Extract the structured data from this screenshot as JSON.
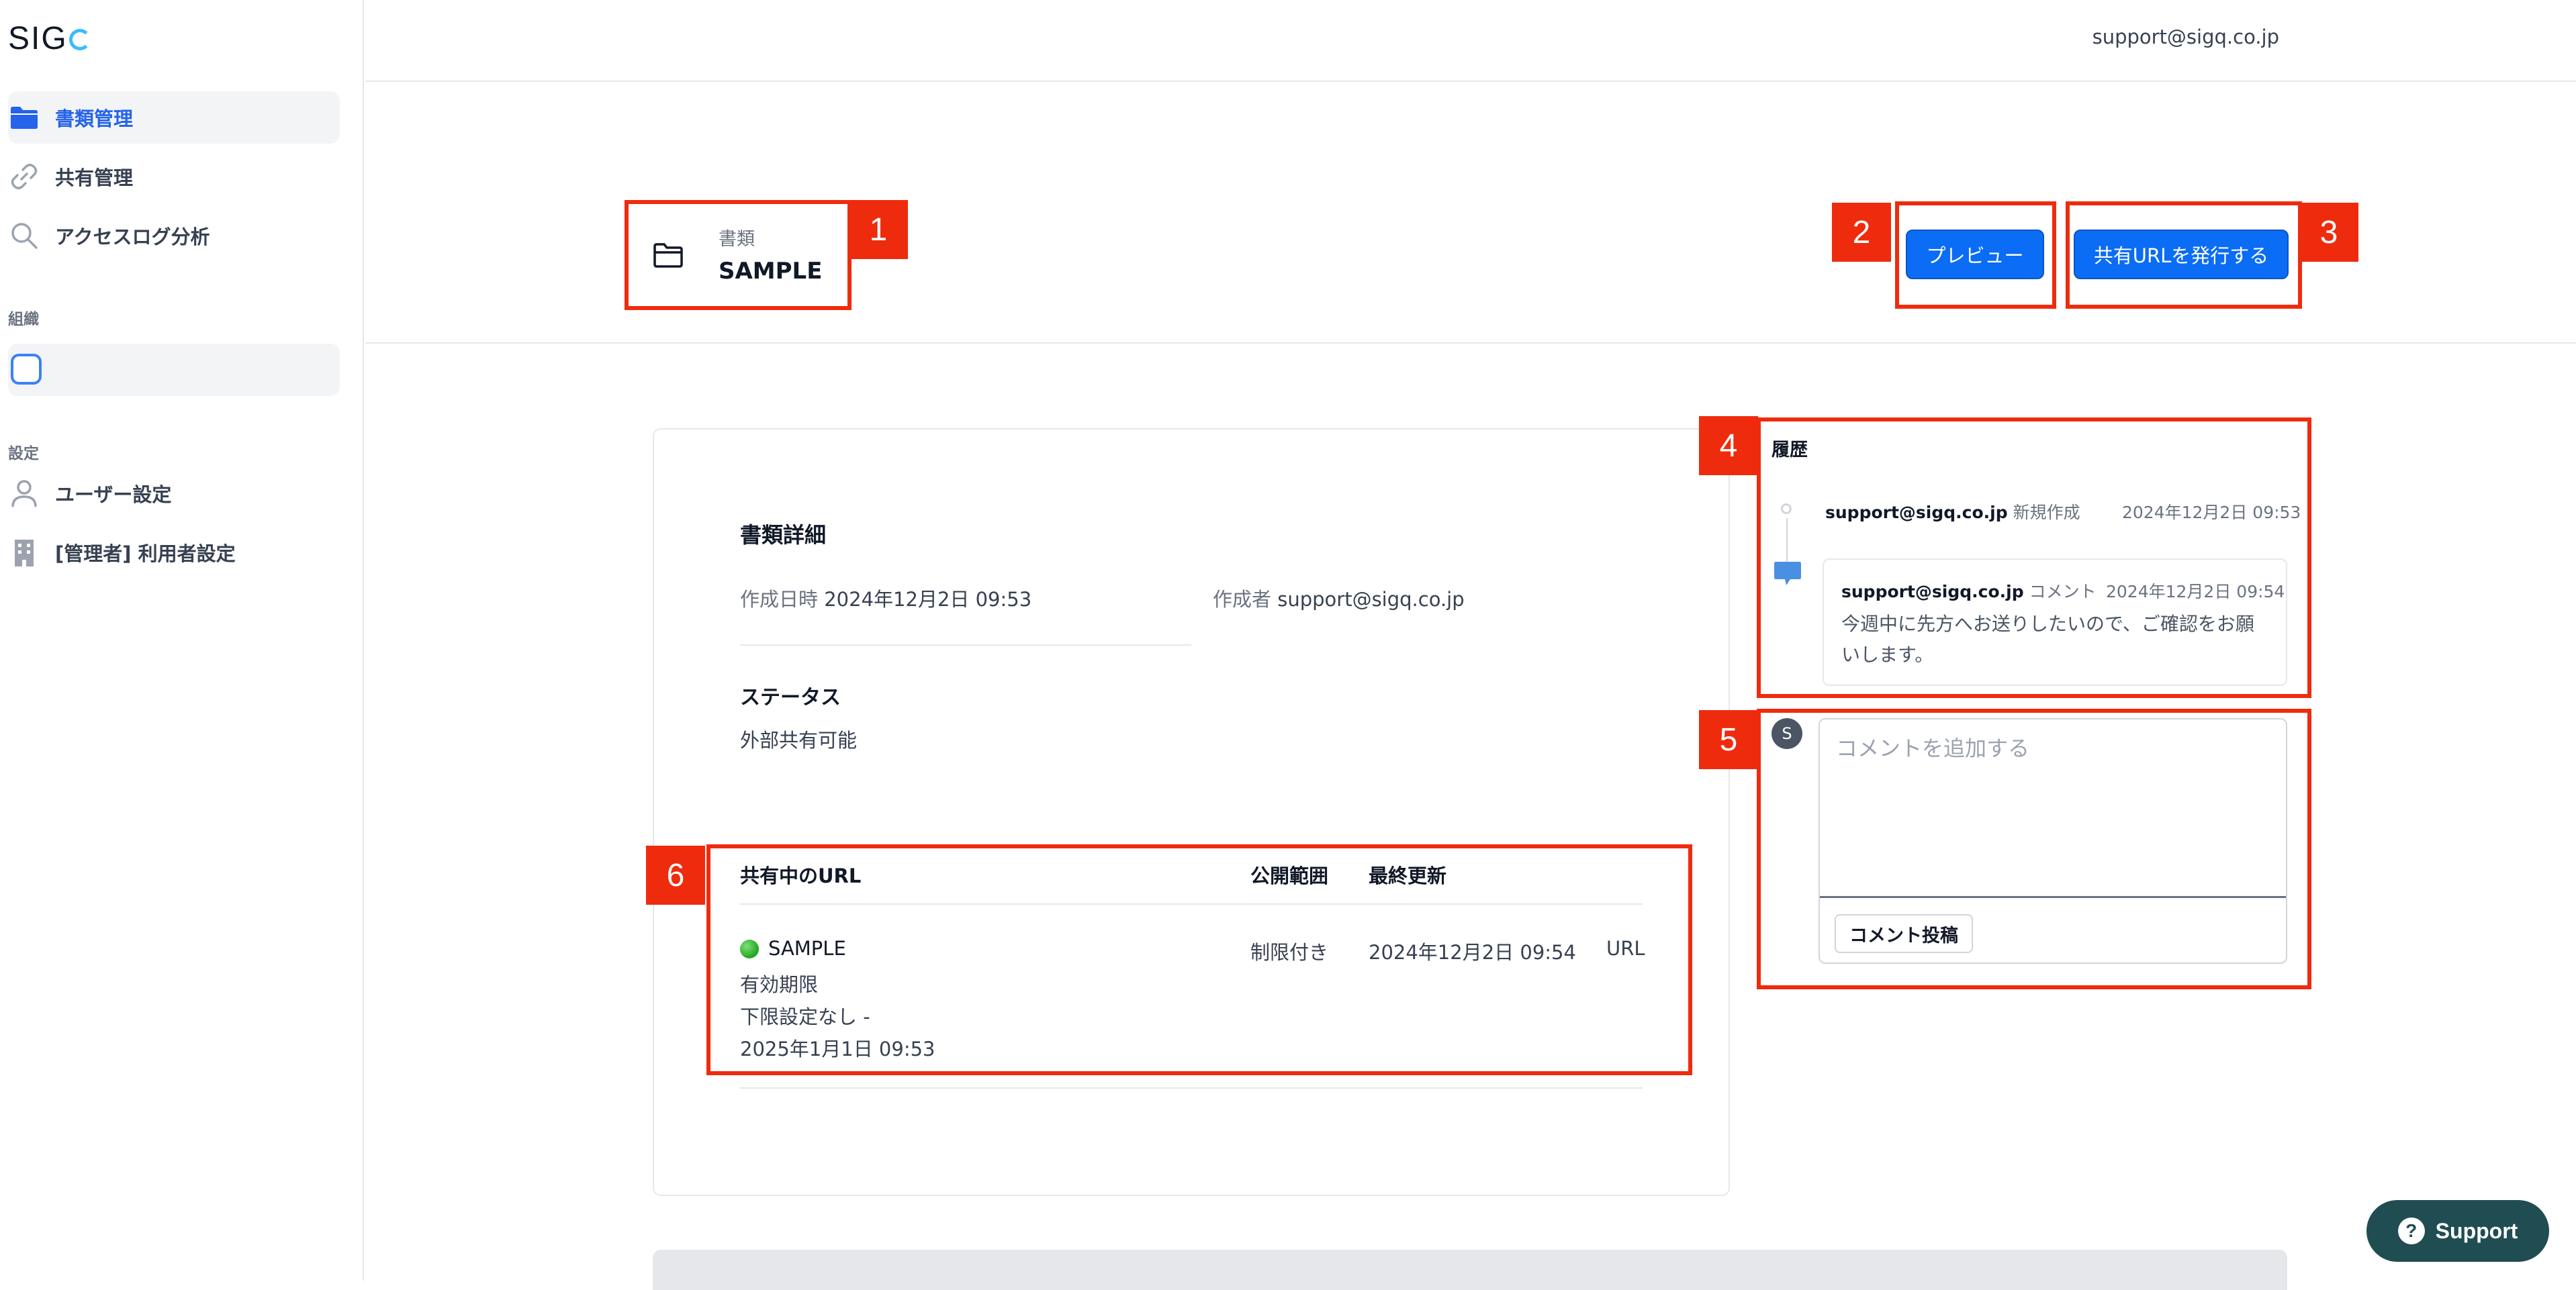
{
  "app": {
    "logo_text": "SIG"
  },
  "sidebar": {
    "items": [
      {
        "label": "書類管理",
        "icon": "folder-icon",
        "active": true
      },
      {
        "label": "共有管理",
        "icon": "link-icon",
        "active": false
      },
      {
        "label": "アクセスログ分析",
        "icon": "search-icon",
        "active": false
      }
    ],
    "org_section": {
      "label": "組織"
    },
    "settings_section": {
      "label": "設定",
      "items": [
        {
          "label": "ユーザー設定",
          "icon": "user-icon"
        },
        {
          "label": "[管理者] 利用者設定",
          "icon": "building-icon"
        }
      ]
    }
  },
  "header": {
    "user_email": "support@sigq.co.jp"
  },
  "document": {
    "kind_label": "書類",
    "name": "SAMPLE",
    "preview_button": "プレビュー",
    "issue_url_button": "共有URLを発行する"
  },
  "details": {
    "title": "書類詳細",
    "created_label": "作成日時",
    "created_value": "2024年12月2日 09:53",
    "author_label": "作成者",
    "author_value": "support@sigq.co.jp",
    "status_title": "ステータス",
    "status_value": "外部共有可能"
  },
  "shared_urls": {
    "headers": {
      "url": "共有中のURL",
      "scope": "公開範囲",
      "updated": "最終更新"
    },
    "rows": [
      {
        "name": "SAMPLE",
        "expiry_label": "有効期限",
        "expiry_lower": "下限設定なし -",
        "expiry_upper": "2025年1月1日 09:53",
        "scope": "制限付き",
        "updated": "2024年12月2日 09:54",
        "url_label": "URL"
      }
    ]
  },
  "history": {
    "title": "履歴",
    "events": [
      {
        "user": "support@sigq.co.jp",
        "action": "新規作成",
        "date": "2024年12月2日 09:53"
      },
      {
        "user": "support@sigq.co.jp",
        "action": "コメント",
        "date": "2024年12月2日 09:54",
        "comment_line1": "今週中に先方へお送りしたいので、ご確認をお願",
        "comment_line2": "いします。"
      }
    ]
  },
  "comment_form": {
    "avatar_initial": "S",
    "placeholder": "コメントを追加する",
    "submit_label": "コメント投稿"
  },
  "annotations": [
    "1",
    "2",
    "3",
    "4",
    "5",
    "6"
  ],
  "support": {
    "label": "Support",
    "icon_glyph": "?"
  },
  "colors": {
    "accent": "#0b6cf5",
    "annotation": "#ef2b0e",
    "status_green": "#1ea51e",
    "support_bg": "#1f4d52"
  }
}
